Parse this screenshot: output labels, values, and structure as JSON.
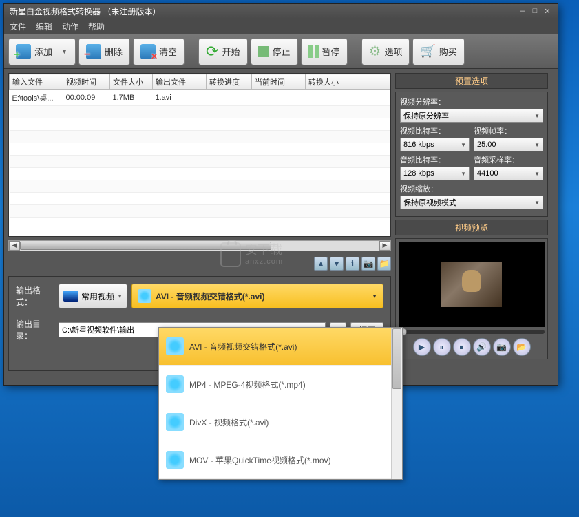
{
  "window": {
    "title": "新星白金视频格式转换器  （未注册版本）"
  },
  "menu": [
    "文件",
    "编辑",
    "动作",
    "帮助"
  ],
  "toolbar": {
    "add": "添加",
    "delete": "删除",
    "clear": "清空",
    "start": "开始",
    "stop": "停止",
    "pause": "暂停",
    "options": "选项",
    "buy": "购买"
  },
  "table": {
    "headers": [
      "输入文件",
      "视频时间",
      "文件大小",
      "输出文件",
      "转换进度",
      "当前时间",
      "转换大小"
    ],
    "rows": [
      {
        "input": "E:\\tools\\桌...",
        "vtime": "00:00:09",
        "fsize": "1.7MB",
        "output": "1.avi",
        "progress": "",
        "ctime": "",
        "csize": ""
      }
    ]
  },
  "output": {
    "format_label": "输出格式：",
    "category": "常用视频",
    "format_selected": "AVI - 音频视频交错格式(*.avi)",
    "dir_label": "输出目录：",
    "dir_value": "C:\\新星视频软件\\输出",
    "open_btn": "打开"
  },
  "dropdown": [
    "AVI - 音频视频交错格式(*.avi)",
    "MP4 - MPEG-4视频格式(*.mp4)",
    "DivX - 视频格式(*.avi)",
    "MOV - 苹果QuickTime视频格式(*.mov)"
  ],
  "preset": {
    "title": "预置选项",
    "res_label": "视频分辨率：",
    "res_value": "保持原分辨率",
    "vbitrate_label": "视频比特率：",
    "vbitrate_value": "816 kbps",
    "fps_label": "视频帧率：",
    "fps_value": "25.00",
    "abitrate_label": "音频比特率：",
    "abitrate_value": "128 kbps",
    "srate_label": "音频采样率：",
    "srate_value": "44100",
    "scale_label": "视频缩放：",
    "scale_value": "保持原视频模式"
  },
  "preview": {
    "title": "视频预览"
  },
  "watermark": {
    "main": "安下载",
    "sub": "anxz.com"
  }
}
